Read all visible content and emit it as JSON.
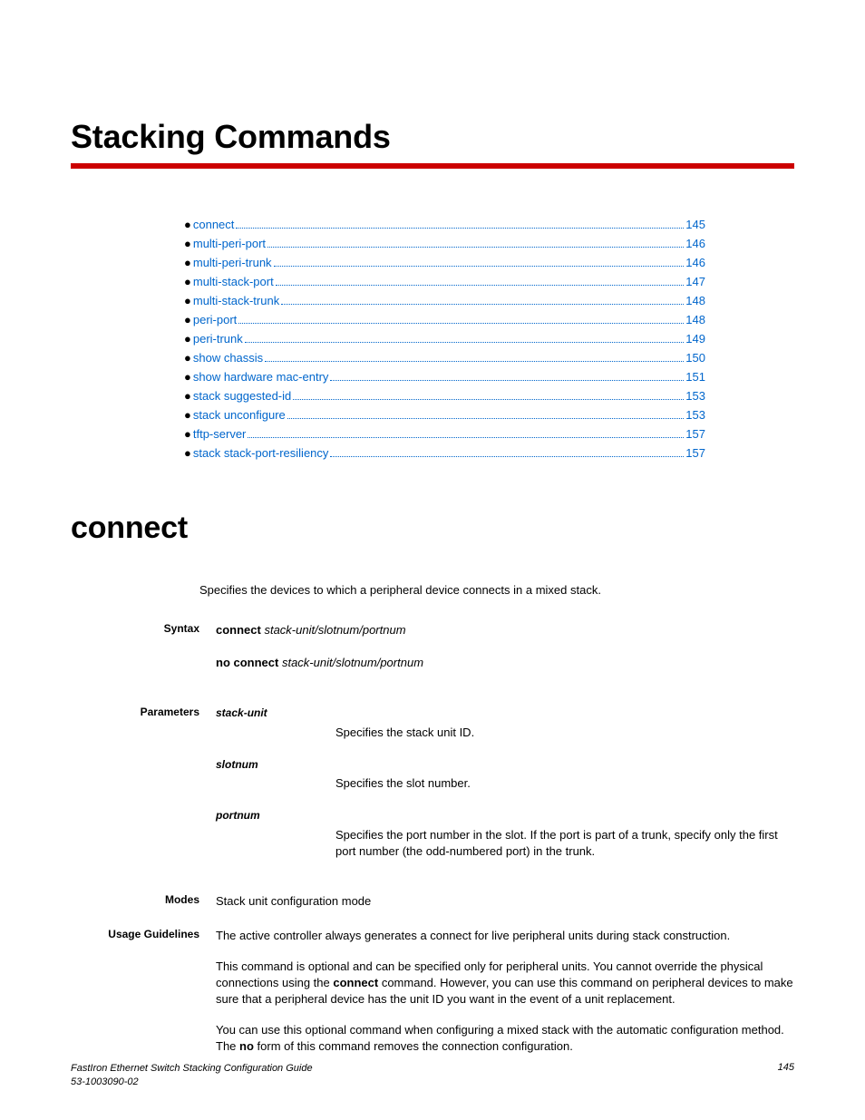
{
  "chapter_title": "Stacking Commands",
  "toc": [
    {
      "label": "connect",
      "page": "145"
    },
    {
      "label": "multi-peri-port ",
      "page": "146"
    },
    {
      "label": "multi-peri-trunk ",
      "page": "146"
    },
    {
      "label": "multi-stack-port ",
      "page": "147"
    },
    {
      "label": "multi-stack-trunk ",
      "page": "148"
    },
    {
      "label": "peri-port ",
      "page": "148"
    },
    {
      "label": "peri-trunk ",
      "page": "149"
    },
    {
      "label": "show chassis ",
      "page": "150"
    },
    {
      "label": "show hardware mac-entry ",
      "page": "151"
    },
    {
      "label": "stack suggested-id",
      "page": "153"
    },
    {
      "label": "stack unconfigure",
      "page": "153"
    },
    {
      "label": "tftp-server",
      "page": "157"
    },
    {
      "label": "stack stack-port-resiliency",
      "page": "157"
    }
  ],
  "section_title": "connect",
  "intro": "Specifies the devices to which a peripheral device connects in a mixed stack.",
  "labels": {
    "syntax": "Syntax",
    "parameters": "Parameters",
    "modes": "Modes",
    "usage": "Usage Guidelines"
  },
  "syntax": {
    "cmd1_bold": "connect ",
    "cmd1_italic": "stack-unit/slotnum/portnum",
    "cmd2_bold": "no connect ",
    "cmd2_italic": "stack-unit/slotnum/portnum"
  },
  "params": [
    {
      "name": "stack-unit",
      "desc": "Specifies the stack unit ID."
    },
    {
      "name": "slotnum",
      "desc": "Specifies the slot number."
    },
    {
      "name": "portnum",
      "desc": "Specifies the port number in the slot. If the port is part of a trunk, specify only the first port number (the odd-numbered port) in the trunk."
    }
  ],
  "modes": "Stack unit configuration mode",
  "usage": {
    "p1": "The active controller always generates a connect for live peripheral units during stack construction.",
    "p2a": "This command is optional and can be specified only for peripheral units. You cannot override the physical connections using the ",
    "p2b": "connect",
    "p2c": " command. However, you can use this command on peripheral devices to make sure that a peripheral device has the unit ID you want in the event of a unit replacement.",
    "p3a": "You can use this optional command when configuring a mixed stack with the automatic configuration method. The ",
    "p3b": "no",
    "p3c": " form of this command removes the connection configuration."
  },
  "footer": {
    "title": "FastIron Ethernet Switch Stacking Configuration Guide",
    "doc": "53-1003090-02",
    "page": "145"
  }
}
